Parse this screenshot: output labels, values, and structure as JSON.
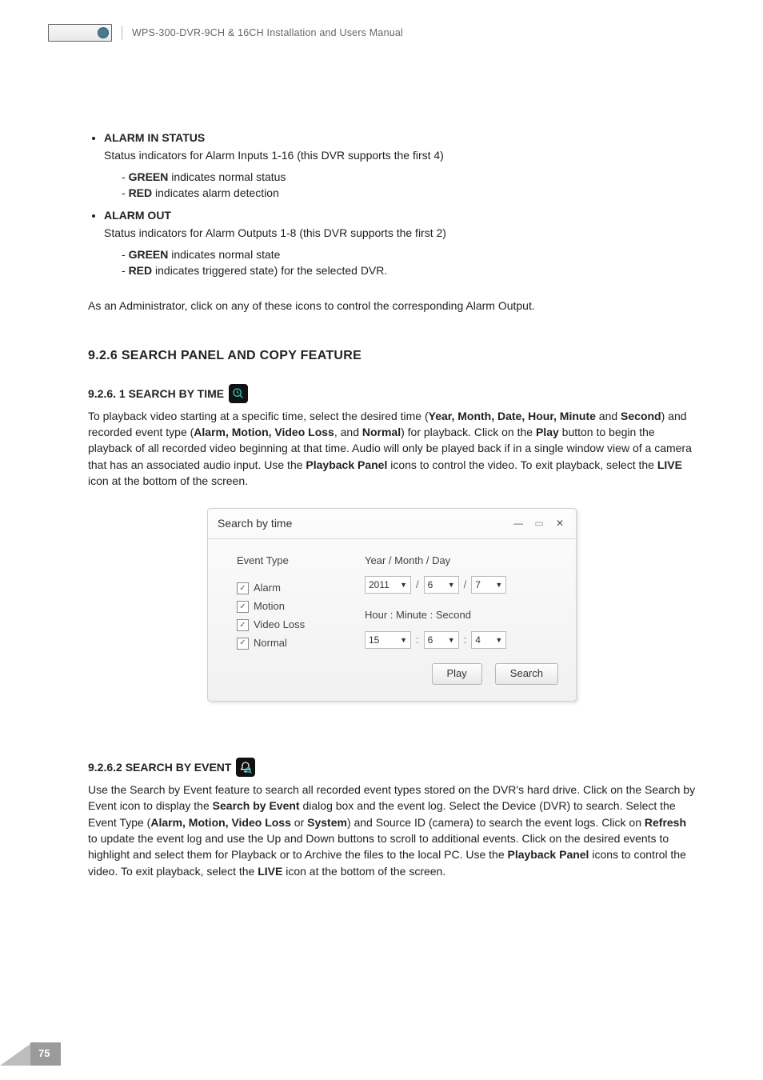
{
  "header": {
    "doc_title": "WPS-300-DVR-9CH & 16CH Installation and Users Manual"
  },
  "alarm_in": {
    "title": "ALARM IN STATUS",
    "desc": "Status indicators for Alarm Inputs 1-16 (this DVR supports the first 4)",
    "green_word": "GREEN",
    "green_rest": " indicates normal status",
    "red_word": "RED",
    "red_rest": " indicates alarm detection"
  },
  "alarm_out": {
    "title": "ALARM OUT",
    "desc": "Status indicators for Alarm Outputs 1-8 (this DVR supports the first 2)",
    "green_word": "GREEN",
    "green_rest": " indicates normal state",
    "red_word": "RED",
    "red_rest": " indicates triggered state) for the selected DVR.",
    "admin_note": "As an Administrator, click on any of these icons to control the corresponding Alarm Output."
  },
  "section": {
    "heading": "9.2.6 SEARCH PANEL AND COPY FEATURE"
  },
  "search_time": {
    "heading": "9.2.6. 1 SEARCH BY TIME",
    "p_a": "To playback video starting at a specific time, select the desired time (",
    "p_b": "Year, Month, Date, Hour, Minute",
    "p_c": " and ",
    "p_d": "Second",
    "p_e": ") and recorded event type (",
    "p_f": "Alarm, Motion, Video Loss",
    "p_g": ", and ",
    "p_h": "Normal",
    "p_i": ") for playback.  Click on the ",
    "p_j": "Play",
    "p_k": " button to begin the playback of all recorded video beginning at that time.  Audio will only be played back if in a single window view of a camera that has an associated audio input.  Use the ",
    "p_l": "Playback Panel",
    "p_m": " icons to control the video.  To exit playback, select the ",
    "p_n": "LIVE",
    "p_o": " icon at the bottom of the screen."
  },
  "dialog": {
    "title": "Search by time",
    "event_type_label": "Event Type",
    "chk": {
      "alarm": "Alarm",
      "motion": "Motion",
      "video_loss": "Video Loss",
      "normal": "Normal"
    },
    "ymd_label": "Year / Month / Day",
    "hms_label": "Hour : Minute : Second",
    "year": "2011",
    "month": "6",
    "day": "7",
    "hour": "15",
    "minute": "6",
    "second": "4",
    "slash": "/",
    "colon": ":",
    "play_btn": "Play",
    "search_btn": "Search"
  },
  "search_event": {
    "heading": "9.2.6.2 SEARCH BY EVENT",
    "a": "Use the Search by Event feature to search all recorded event types stored on the DVR's hard drive.  Click on the Search by Event icon to display the ",
    "b": "Search by Event",
    "c": " dialog box and the event log.  Select the Device (DVR) to search.  Select the Event Type (",
    "d": "Alarm, Motion, Video Loss",
    "e": " or ",
    "f": "System",
    "g": ") and Source ID (camera) to search the event logs.  Click on ",
    "h": "Refresh",
    "i": " to update the event log and use the Up and Down buttons to scroll to additional events.  Click on the desired events to highlight and select them for Playback or to Archive the files to the local PC.  Use the ",
    "j": "Playback Panel",
    "k": " icons to control the video.  To exit playback, select the ",
    "l": "LIVE",
    "m": " icon at the bottom of the screen."
  },
  "footer": {
    "page": "75"
  }
}
